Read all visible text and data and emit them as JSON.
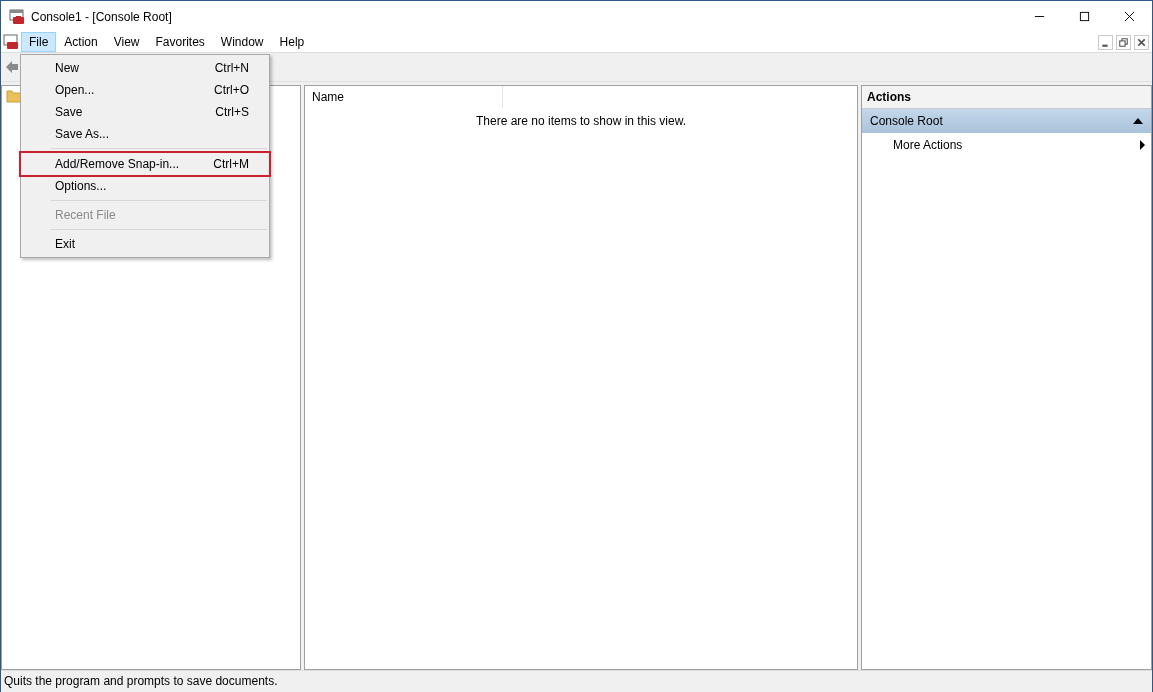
{
  "window": {
    "title": "Console1 - [Console Root]"
  },
  "menu_bar": [
    {
      "label": "File",
      "selected": true
    },
    {
      "label": "Action",
      "selected": false
    },
    {
      "label": "View",
      "selected": false
    },
    {
      "label": "Favorites",
      "selected": false
    },
    {
      "label": "Window",
      "selected": false
    },
    {
      "label": "Help",
      "selected": false
    }
  ],
  "file_menu": [
    {
      "kind": "item",
      "label": "New",
      "shortcut": "Ctrl+N",
      "disabled": false,
      "outlined": false
    },
    {
      "kind": "item",
      "label": "Open...",
      "shortcut": "Ctrl+O",
      "disabled": false,
      "outlined": false
    },
    {
      "kind": "item",
      "label": "Save",
      "shortcut": "Ctrl+S",
      "disabled": false,
      "outlined": false
    },
    {
      "kind": "item",
      "label": "Save As...",
      "disabled": false,
      "outlined": false
    },
    {
      "kind": "separator"
    },
    {
      "kind": "item",
      "label": "Add/Remove Snap-in...",
      "shortcut": "Ctrl+M",
      "disabled": false,
      "outlined": true
    },
    {
      "kind": "item",
      "label": "Options...",
      "disabled": false,
      "outlined": false
    },
    {
      "kind": "separator"
    },
    {
      "kind": "item",
      "label": "Recent File",
      "disabled": true,
      "outlined": false
    },
    {
      "kind": "separator"
    },
    {
      "kind": "item",
      "label": "Exit",
      "disabled": false,
      "outlined": false
    }
  ],
  "list_view": {
    "columns": [
      "Name"
    ],
    "empty_message": "There are no items to show in this view."
  },
  "actions_pane": {
    "title": "Actions",
    "section": "Console Root",
    "items": [
      "More Actions"
    ]
  },
  "status_bar": "Quits the program and prompts to save documents."
}
